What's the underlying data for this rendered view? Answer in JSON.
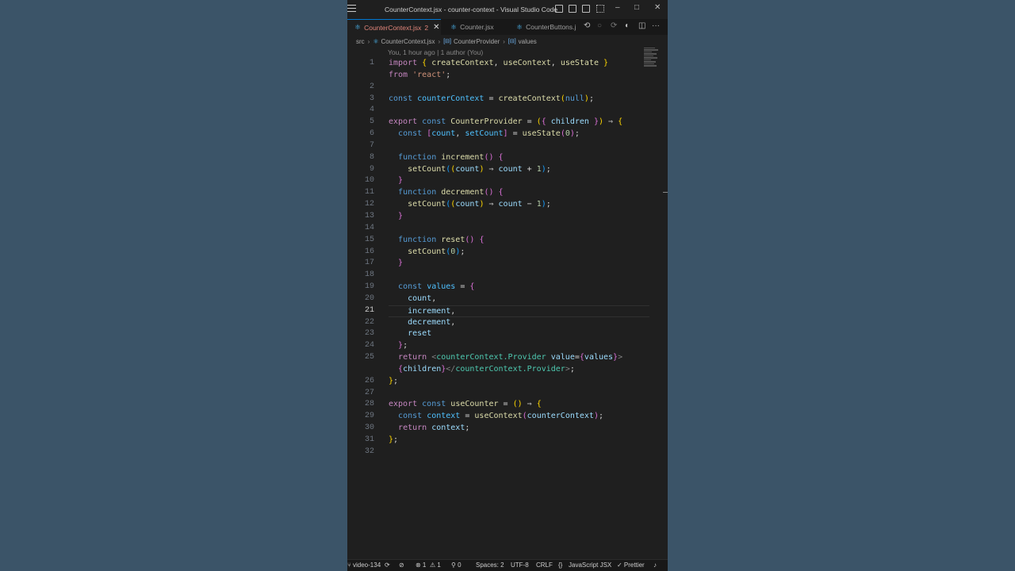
{
  "window": {
    "title": "CounterContext.jsx - counter-context - Visual Studio Code",
    "minimize": "–",
    "maximize": "□",
    "close": "✕"
  },
  "tabs": [
    {
      "label": "CounterContext.jsx",
      "badge": "2",
      "close": "✕",
      "active": true
    },
    {
      "label": "Counter.jsx",
      "active": false
    },
    {
      "label": "CounterButtons.j",
      "active": false
    }
  ],
  "editor_actions": [
    "⟲",
    "○",
    "⟳",
    "◐",
    "◫",
    "···"
  ],
  "breadcrumb": {
    "folder": "src",
    "file": "CounterContext.jsx",
    "symbol1": "CounterProvider",
    "symbol2": "values",
    "separator": "›"
  },
  "blame": "You, 1 hour ago | 1 author (You)",
  "line_numbers": [
    "1",
    "",
    "2",
    "3",
    "4",
    "5",
    "6",
    "7",
    "8",
    "9",
    "10",
    "11",
    "12",
    "13",
    "14",
    "15",
    "16",
    "17",
    "18",
    "19",
    "20",
    "21",
    "22",
    "23",
    "24",
    "25",
    "",
    "26",
    "27",
    "28",
    "29",
    "30",
    "31",
    "32"
  ],
  "active_line": "21",
  "statusbar": {
    "branch": "video-134",
    "sync": "⟳",
    "errors": "⊗ 1",
    "warnings": "⚠ 1",
    "ports": "⚲ 0",
    "spaces": "Spaces: 2",
    "encoding": "UTF-8",
    "eol": "CRLF",
    "language": "JavaScript JSX",
    "formatter": "✓ Prettier",
    "bell": "🔔"
  },
  "colors": {
    "accent": "#0078d4",
    "editor_bg": "#1f1f1f",
    "page_bg": "#3b5468",
    "active_tab_text": "#e0857a"
  }
}
